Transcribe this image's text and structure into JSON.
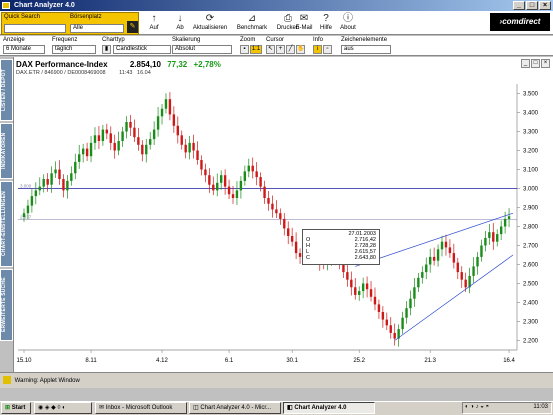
{
  "window": {
    "title": "Chart Analyzer 4.0",
    "min": "_",
    "max": "□",
    "close": "×"
  },
  "toolbar": {
    "quick_search_label": "Quick Search",
    "exchange_label": "Börsenplatz",
    "exchange_value": "Alle",
    "buttons": [
      {
        "label": "Auf",
        "icon": "↑"
      },
      {
        "label": "Ab",
        "icon": "↓"
      },
      {
        "label": "Aktualisieren",
        "icon": "⟳"
      },
      {
        "label": "Benchmark",
        "icon": "⊿"
      },
      {
        "label": "Drucken",
        "icon": "⎙"
      },
      {
        "label": "E-Mail",
        "icon": "✉"
      },
      {
        "label": "Hilfe",
        "icon": "?"
      },
      {
        "label": "About",
        "icon": "ⓘ"
      }
    ],
    "brand": "›comdirect"
  },
  "options": {
    "anzeige_label": "Anzeige",
    "anzeige_value": "6 Monate",
    "frequenz_label": "Frequenz",
    "frequenz_value": "täglich",
    "charttyp_label": "Charttyp",
    "charttyp_value": "Candlestick",
    "skalierung_label": "Skalierung",
    "skalierung_value": "Absolut",
    "zoom_label": "Zoom",
    "zoom_value": "1:1",
    "cursor_label": "Cursor",
    "info_label": "Info",
    "zeichen_label": "Zeichenelemente",
    "zeichen_value": "aus"
  },
  "sidebar": {
    "tabs": [
      "LISTEN / DEPOT",
      "INDIKATOREN",
      "CHART-EINSTELLUNGEN",
      "ERWEITERTE SUCHE"
    ]
  },
  "chart_header": {
    "name": "DAX Performance-Index",
    "price": "2.854,10",
    "change": "77,32",
    "change_pct": "+2,78%",
    "meta": "DAX.ETR  /  846900  /  DE0008469008",
    "time": "11:43",
    "second_time": "16.04"
  },
  "tooltip": {
    "date": "27.01.2003",
    "rows": [
      {
        "k": "O",
        "v": "2.716,42"
      },
      {
        "k": "H",
        "v": "2.728,28"
      },
      {
        "k": "L",
        "v": "2.615,57"
      },
      {
        "k": "C",
        "v": "2.643,80"
      }
    ]
  },
  "colors": {
    "up": "#1a8c1a",
    "down": "#cc1a1a",
    "hline": "#1a1aa0",
    "trend": "#2a4ad0",
    "change_green": "#1a9a1a"
  },
  "chart_data": {
    "type": "candlestick",
    "x_ticks": [
      "15.10",
      "8.11",
      "4.12",
      "6.1",
      "30.1",
      "25.2",
      "21.3",
      "16.4"
    ],
    "y_ticks": [
      "2.200",
      "2.300",
      "2.400",
      "2.500",
      "2.600",
      "2.700",
      "2.800",
      "2.900",
      "3.000",
      "3.100",
      "3.200",
      "3.300",
      "3.400",
      "3.500"
    ],
    "ylim": [
      2150,
      3550
    ],
    "horizontal_lines": [
      {
        "value": 3000,
        "label": "3.000"
      },
      {
        "value": 2837,
        "label": "2.837"
      }
    ],
    "closes": [
      2870,
      2910,
      2960,
      2990,
      3010,
      3050,
      3020,
      3080,
      3100,
      3050,
      2990,
      3040,
      3080,
      3140,
      3180,
      3210,
      3170,
      3240,
      3280,
      3250,
      3310,
      3290,
      3240,
      3200,
      3250,
      3300,
      3350,
      3320,
      3270,
      3230,
      3180,
      3230,
      3260,
      3310,
      3380,
      3420,
      3470,
      3390,
      3330,
      3280,
      3230,
      3190,
      3240,
      3200,
      3150,
      3100,
      3070,
      3020,
      2990,
      3030,
      3070,
      3010,
      2970,
      2950,
      2990,
      3040,
      3090,
      3120,
      3090,
      3060,
      3010,
      2950,
      2920,
      2890,
      2870,
      2840,
      2790,
      2750,
      2720,
      2660,
      2640,
      2680,
      2720,
      2690,
      2650,
      2610,
      2600,
      2630,
      2680,
      2640,
      2600,
      2560,
      2520,
      2480,
      2440,
      2460,
      2500,
      2470,
      2430,
      2390,
      2350,
      2310,
      2280,
      2240,
      2210,
      2260,
      2320,
      2370,
      2420,
      2480,
      2530,
      2560,
      2600,
      2640,
      2620,
      2680,
      2720,
      2690,
      2660,
      2610,
      2560,
      2520,
      2480,
      2540,
      2590,
      2640,
      2700,
      2740,
      2770,
      2720,
      2760,
      2800,
      2840,
      2854
    ]
  }
}
